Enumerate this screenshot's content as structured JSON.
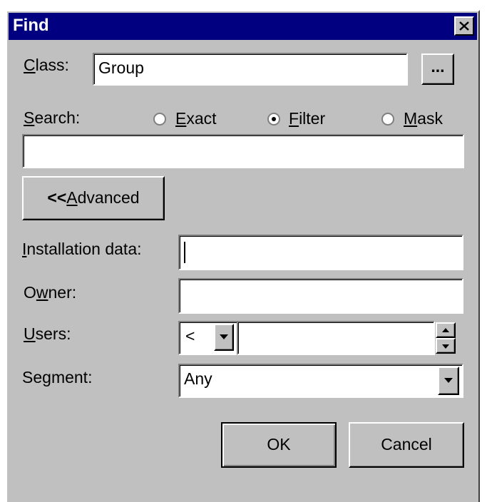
{
  "window": {
    "title": "Find"
  },
  "class_field": {
    "label_accel": "C",
    "label_rest": "lass:",
    "value": "Group",
    "browse_label": "..."
  },
  "search": {
    "label_accel": "S",
    "label_rest": "earch:",
    "value": "",
    "options": [
      {
        "accel": "E",
        "rest": "xact",
        "selected": false
      },
      {
        "accel": "F",
        "rest": "ilter",
        "selected": true
      },
      {
        "accel": "M",
        "rest": "ask",
        "selected": false
      }
    ]
  },
  "advanced_button": {
    "prefix": "<<",
    "accel": "A",
    "rest": "dvanced"
  },
  "installation_data": {
    "label_accel": "I",
    "label_rest": "nstallation data:",
    "value": ""
  },
  "owner": {
    "label_pre": "O",
    "label_accel": "w",
    "label_rest": "ner:",
    "value": ""
  },
  "users": {
    "label_accel": "U",
    "label_rest": "sers:",
    "operator": "<",
    "value": ""
  },
  "segment": {
    "label_pre": "Se",
    "label_accel": "g",
    "label_rest": "ment:",
    "value": "Any"
  },
  "buttons": {
    "ok": "OK",
    "cancel": "Cancel"
  }
}
